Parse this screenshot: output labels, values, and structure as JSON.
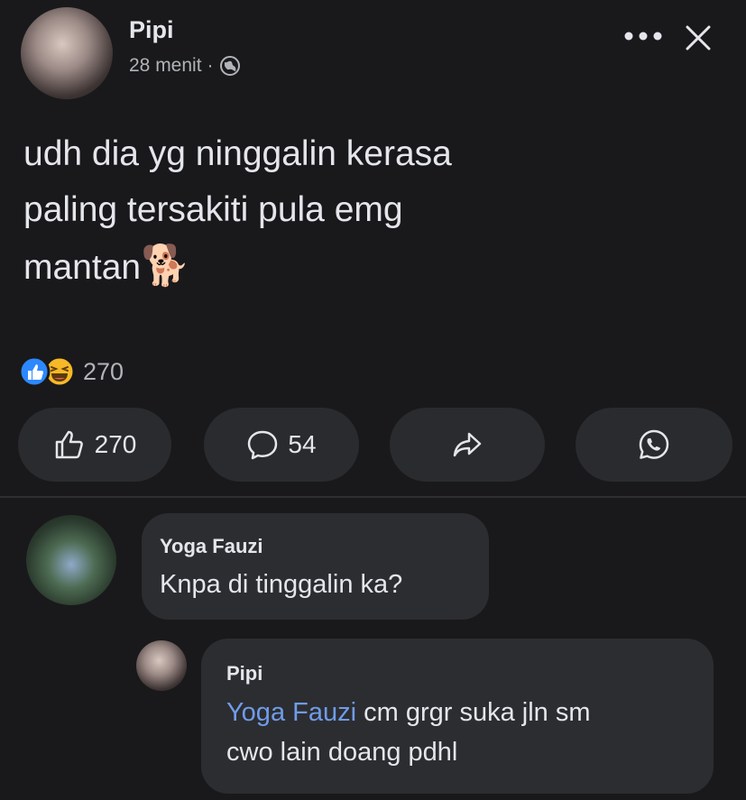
{
  "post": {
    "author": "Pipi",
    "time": "28 menit",
    "separator": "·",
    "audience_icon": "globe-icon",
    "text_line1": "udh dia yg ninggalin kerasa",
    "text_line2": "paling tersakiti pula emg",
    "text_line3": "mantan",
    "emoji": "🐕",
    "reaction_icons": [
      "like-icon",
      "haha-icon"
    ],
    "reaction_count": "270"
  },
  "actions": {
    "like_count": "270",
    "comment_count": "54",
    "share_icon": "share-icon",
    "whatsapp_icon": "whatsapp-icon"
  },
  "comments": [
    {
      "author": "Yoga Fauzi",
      "text": "Knpa di tinggalin ka?"
    },
    {
      "author": "Pipi",
      "mention": "Yoga Fauzi",
      "text_line1": " cm grgr suka jln sm",
      "text_line2": "cwo lain doang pdhl"
    }
  ],
  "colors": {
    "background": "#19191b",
    "bubble": "#2c2d31",
    "pill": "#2a2b2e",
    "mention": "#6f9ce8",
    "like_blue": "#2d88ff"
  }
}
